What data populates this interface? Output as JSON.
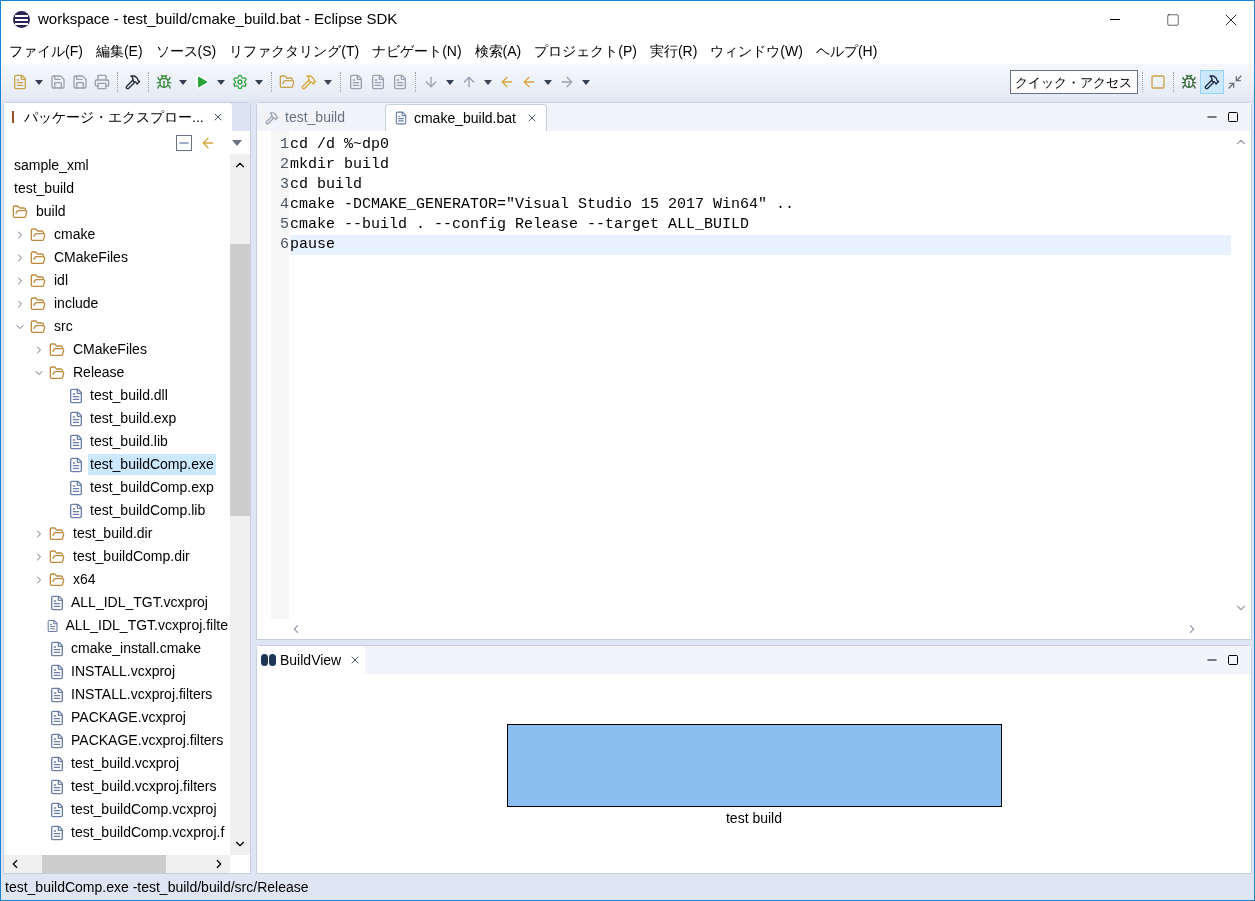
{
  "window": {
    "title": "workspace - test_build/cmake_build.bat - Eclipse SDK"
  },
  "menu": [
    "ファイル(F)",
    "編集(E)",
    "ソース(S)",
    "リファクタリング(T)",
    "ナビゲート(N)",
    "検索(A)",
    "プロジェクト(P)",
    "実行(R)",
    "ウィンドウ(W)",
    "ヘルプ(H)"
  ],
  "quick_access": {
    "placeholder": "クイック・アクセス"
  },
  "explorer": {
    "tab": "パッケージ・エクスプロー...",
    "tree": [
      {
        "label": "sample_xml",
        "kind": "project",
        "selected": false
      },
      {
        "label": "test_build",
        "kind": "project",
        "selected": false
      },
      {
        "label": "build",
        "kind": "folder",
        "selected": false,
        "children": [
          {
            "label": "cmake",
            "kind": "folder",
            "expanded": false,
            "selected": false
          },
          {
            "label": "CMakeFiles",
            "kind": "folder",
            "expanded": false,
            "selected": false
          },
          {
            "label": "idl",
            "kind": "folder",
            "expanded": false,
            "selected": false
          },
          {
            "label": "include",
            "kind": "folder",
            "expanded": false,
            "selected": false
          },
          {
            "label": "src",
            "kind": "folder",
            "expanded": true,
            "selected": false,
            "children": [
              {
                "label": "CMakeFiles",
                "kind": "folder",
                "expanded": false,
                "selected": false
              },
              {
                "label": "Release",
                "kind": "folder",
                "expanded": true,
                "selected": false,
                "children": [
                  {
                    "label": "test_build.dll",
                    "kind": "file",
                    "selected": false
                  },
                  {
                    "label": "test_build.exp",
                    "kind": "file",
                    "selected": false
                  },
                  {
                    "label": "test_build.lib",
                    "kind": "file",
                    "selected": false
                  },
                  {
                    "label": "test_buildComp.exe",
                    "kind": "file",
                    "selected": true
                  },
                  {
                    "label": "test_buildComp.exp",
                    "kind": "file",
                    "selected": false
                  },
                  {
                    "label": "test_buildComp.lib",
                    "kind": "file",
                    "selected": false
                  }
                ]
              },
              {
                "label": "test_build.dir",
                "kind": "folder",
                "expanded": false,
                "selected": false
              },
              {
                "label": "test_buildComp.dir",
                "kind": "folder",
                "expanded": false,
                "selected": false
              },
              {
                "label": "x64",
                "kind": "folder",
                "expanded": false,
                "selected": false
              },
              {
                "label": "ALL_IDL_TGT.vcxproj",
                "kind": "file",
                "selected": false
              },
              {
                "label": "ALL_IDL_TGT.vcxproj.filte",
                "kind": "file",
                "selected": false
              },
              {
                "label": "cmake_install.cmake",
                "kind": "file",
                "selected": false
              },
              {
                "label": "INSTALL.vcxproj",
                "kind": "file",
                "selected": false
              },
              {
                "label": "INSTALL.vcxproj.filters",
                "kind": "file",
                "selected": false
              },
              {
                "label": "PACKAGE.vcxproj",
                "kind": "file",
                "selected": false
              },
              {
                "label": "PACKAGE.vcxproj.filters",
                "kind": "file",
                "selected": false
              },
              {
                "label": "test_build.vcxproj",
                "kind": "file",
                "selected": false
              },
              {
                "label": "test_build.vcxproj.filters",
                "kind": "file",
                "selected": false
              },
              {
                "label": "test_buildComp.vcxproj",
                "kind": "file",
                "selected": false
              },
              {
                "label": "test_buildComp.vcxproj.f",
                "kind": "file",
                "selected": false
              }
            ]
          }
        ]
      }
    ]
  },
  "editor": {
    "tabs": [
      {
        "label": "test_build",
        "kind": "project",
        "selected": false
      },
      {
        "label": "cmake_build.bat",
        "kind": "file",
        "selected": true
      }
    ],
    "lines": [
      {
        "number": "1",
        "text": "cd /d %~dp0",
        "current": false
      },
      {
        "number": "2",
        "text": "mkdir build",
        "current": false
      },
      {
        "number": "3",
        "text": "cd build",
        "current": false
      },
      {
        "number": "4",
        "text": "cmake -DCMAKE_GENERATOR=\"Visual Studio 15 2017 Win64\" ..",
        "current": false
      },
      {
        "number": "5",
        "text": "cmake --build . --config Release --target ALL_BUILD",
        "current": false
      },
      {
        "number": "6",
        "text": "pause",
        "current": true
      }
    ]
  },
  "build_view": {
    "tab": "BuildView",
    "node": {
      "label": "test build"
    }
  },
  "status_bar": "test_buildComp.exe -test_build/build/src/Release"
}
